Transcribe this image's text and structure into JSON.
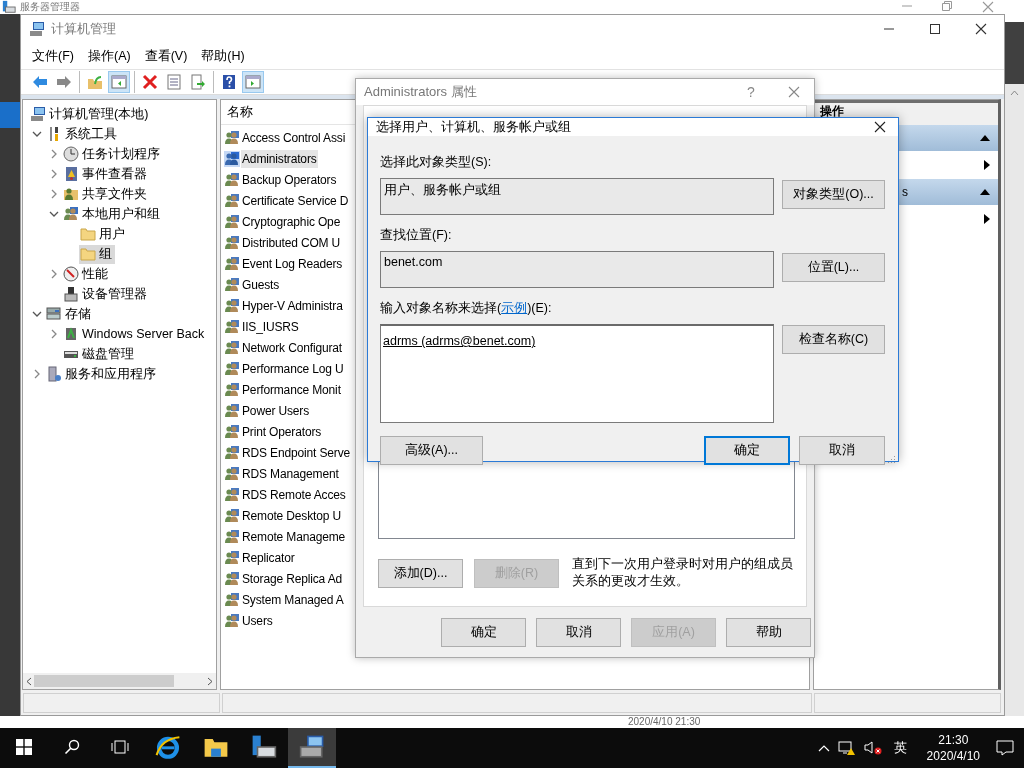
{
  "background_window": {
    "title": "服务器管理器",
    "footer_time": "2020/4/10 21:30"
  },
  "window": {
    "title": "计算机管理",
    "menu": [
      {
        "label": "文件(F)"
      },
      {
        "label": "操作(A)"
      },
      {
        "label": "查看(V)"
      },
      {
        "label": "帮助(H)"
      }
    ],
    "toolbar": [
      [
        {
          "kind": "back",
          "pressed": false
        },
        {
          "kind": "forward",
          "pressed": false
        }
      ],
      [
        {
          "kind": "up",
          "pressed": false
        },
        {
          "kind": "tree",
          "pressed": true
        }
      ],
      [
        {
          "kind": "delete",
          "pressed": false
        },
        {
          "kind": "properties",
          "pressed": false
        },
        {
          "kind": "export",
          "pressed": false
        }
      ],
      [
        {
          "kind": "help",
          "pressed": false
        },
        {
          "kind": "actions",
          "pressed": true
        }
      ]
    ],
    "tree": [
      {
        "label": "计算机管理(本地)",
        "kind": "computer",
        "selected": false,
        "children": [
          {
            "label": "系统工具",
            "kind": "tools",
            "expanded": true,
            "selected": false,
            "children": [
              {
                "label": "任务计划程序",
                "kind": "clock",
                "expanded": false,
                "selected": false
              },
              {
                "label": "事件查看器",
                "kind": "event",
                "expanded": false,
                "selected": false
              },
              {
                "label": "共享文件夹",
                "kind": "share",
                "expanded": false,
                "selected": false
              },
              {
                "label": "本地用户和组",
                "kind": "users",
                "expanded": true,
                "selected": false,
                "children": [
                  {
                    "label": "用户",
                    "kind": "folder",
                    "selected": false
                  },
                  {
                    "label": "组",
                    "kind": "folder",
                    "selected": true
                  }
                ]
              },
              {
                "label": "性能",
                "kind": "perf",
                "expanded": false,
                "selected": false
              },
              {
                "label": "设备管理器",
                "kind": "device",
                "selected": false
              }
            ]
          },
          {
            "label": "存储",
            "kind": "storage",
            "expanded": true,
            "selected": false,
            "children": [
              {
                "label": "Windows Server Back",
                "kind": "backup",
                "expanded": false,
                "selected": false
              },
              {
                "label": "磁盘管理",
                "kind": "disk",
                "selected": false
              }
            ]
          },
          {
            "label": "服务和应用程序",
            "kind": "services",
            "expanded": false,
            "selected": false
          }
        ]
      }
    ],
    "list": {
      "column": "名称",
      "rows": [
        {
          "label": "Access Control Assi",
          "selected": false
        },
        {
          "label": "Administrators",
          "selected": true
        },
        {
          "label": "Backup Operators",
          "selected": false
        },
        {
          "label": "Certificate Service D",
          "selected": false
        },
        {
          "label": "Cryptographic Ope",
          "selected": false
        },
        {
          "label": "Distributed COM U",
          "selected": false
        },
        {
          "label": "Event Log Readers",
          "selected": false
        },
        {
          "label": "Guests",
          "selected": false
        },
        {
          "label": "Hyper-V Administra",
          "selected": false
        },
        {
          "label": "IIS_IUSRS",
          "selected": false
        },
        {
          "label": "Network Configurat",
          "selected": false
        },
        {
          "label": "Performance Log U",
          "selected": false
        },
        {
          "label": "Performance Monit",
          "selected": false
        },
        {
          "label": "Power Users",
          "selected": false
        },
        {
          "label": "Print Operators",
          "selected": false
        },
        {
          "label": "RDS Endpoint Serve",
          "selected": false
        },
        {
          "label": "RDS Management",
          "selected": false
        },
        {
          "label": "RDS Remote Acces",
          "selected": false
        },
        {
          "label": "Remote Desktop U",
          "selected": false
        },
        {
          "label": "Remote Manageme",
          "selected": false
        },
        {
          "label": "Replicator",
          "selected": false
        },
        {
          "label": "Storage Replica Ad",
          "selected": false
        },
        {
          "label": "System Managed A",
          "selected": false
        },
        {
          "label": "Users",
          "selected": false
        }
      ]
    },
    "actions": {
      "title": "操作",
      "entries": [
        {
          "kind": "header"
        },
        {
          "kind": "item"
        },
        {
          "kind": "header",
          "label": "s"
        },
        {
          "kind": "item"
        }
      ]
    }
  },
  "properties_dialog": {
    "title": "Administrators 属性",
    "help": "?",
    "member_buttons": [
      {
        "label": "添加(D)...",
        "disabled": false
      },
      {
        "label": "删除(R)",
        "disabled": true
      }
    ],
    "note": "直到下一次用户登录时对用户的组成员关系的更改才生效。",
    "buttons": [
      {
        "label": "确定",
        "disabled": false
      },
      {
        "label": "取消",
        "disabled": false
      },
      {
        "label": "应用(A)",
        "disabled": true
      },
      {
        "label": "帮助",
        "disabled": false
      }
    ]
  },
  "select_dialog": {
    "title": "选择用户、计算机、服务帐户或组",
    "fields": [
      {
        "label": "选择此对象类型(S):",
        "value": "用户、服务帐户或组",
        "button": "对象类型(O)..."
      },
      {
        "label": "查找位置(F):",
        "value": "benet.com",
        "button": "位置(L)..."
      }
    ],
    "names_label": {
      "before": "输入对象名称来选择(",
      "link": "示例",
      "after": ")(E):"
    },
    "names_value": "adrms (adrms@benet.com)",
    "check_button": "检查名称(C)",
    "buttons": [
      {
        "label": "高级(A)...",
        "default": false
      },
      {
        "label": "确定",
        "default": true
      },
      {
        "label": "取消",
        "default": false
      }
    ]
  },
  "taskbar": {
    "apps": [
      {
        "kind": "ie",
        "active": false
      },
      {
        "kind": "explorer",
        "active": false
      },
      {
        "kind": "server",
        "active": false
      },
      {
        "kind": "computer",
        "active": true
      }
    ],
    "ime": "英",
    "time": "21:30",
    "date": "2020/4/10"
  }
}
